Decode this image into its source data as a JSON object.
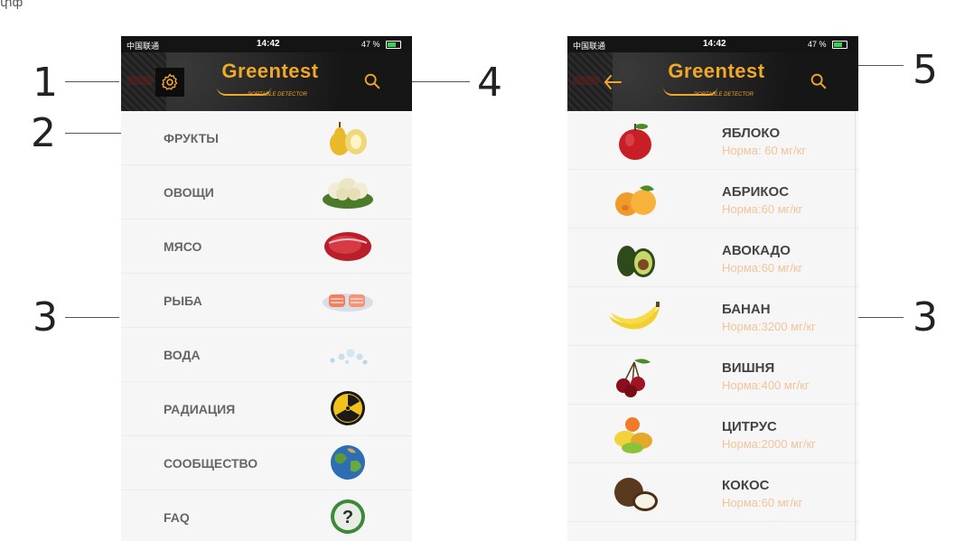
{
  "page_header_fragment": "փф",
  "callouts": {
    "c1": "1",
    "c2": "2",
    "c3_left": "3",
    "c4": "4",
    "c5": "5",
    "c3_right": "3"
  },
  "left_phone": {
    "status": {
      "carrier": "中国联通",
      "time": "14:42",
      "battery": "47 %"
    },
    "app": {
      "brand": "Greentest",
      "subtitle": "PORTABLE DETECTOR"
    },
    "categories": [
      {
        "label": "ФРУКТЫ",
        "icon": "pears-image"
      },
      {
        "label": "ОВОЩИ",
        "icon": "cauliflower-image"
      },
      {
        "label": "МЯСО",
        "icon": "meat-image"
      },
      {
        "label": "РЫБА",
        "icon": "fish-image"
      },
      {
        "label": "ВОДА",
        "icon": "water-image"
      },
      {
        "label": "РАДИАЦИЯ",
        "icon": "radiation-icon"
      },
      {
        "label": "СООБЩЕСТВО",
        "icon": "earth-image"
      },
      {
        "label": "FAQ",
        "icon": "question-icon"
      }
    ]
  },
  "right_phone": {
    "status": {
      "carrier": "中国联通",
      "time": "14:42",
      "battery": "47 %"
    },
    "app": {
      "brand": "Greentest",
      "subtitle": "PORTABLE DETECTOR"
    },
    "fruits": [
      {
        "name": "ЯБЛОКО",
        "norm": "Норма: 60 мг/кг",
        "icon": "apple-image"
      },
      {
        "name": "АБРИКОС",
        "norm": "Норма:60 мг/кг",
        "icon": "apricot-image"
      },
      {
        "name": "АВОКАДО",
        "norm": "Норма:60 мг/кг",
        "icon": "avocado-image"
      },
      {
        "name": "БАНАН",
        "norm": "Норма:3200 мг/кг",
        "icon": "banana-image"
      },
      {
        "name": "ВИШНЯ",
        "norm": "Норма:400 мг/кг",
        "icon": "cherry-image"
      },
      {
        "name": "ЦИТРУС",
        "norm": "Норма:2000 мг/кг",
        "icon": "citrus-image"
      },
      {
        "name": "КОКОС",
        "norm": "Норма:60 мг/кг",
        "icon": "coconut-image"
      }
    ]
  },
  "colors": {
    "brand": "#f0a82a",
    "norm_text": "#f3c49a",
    "header_bg": "#161616"
  }
}
